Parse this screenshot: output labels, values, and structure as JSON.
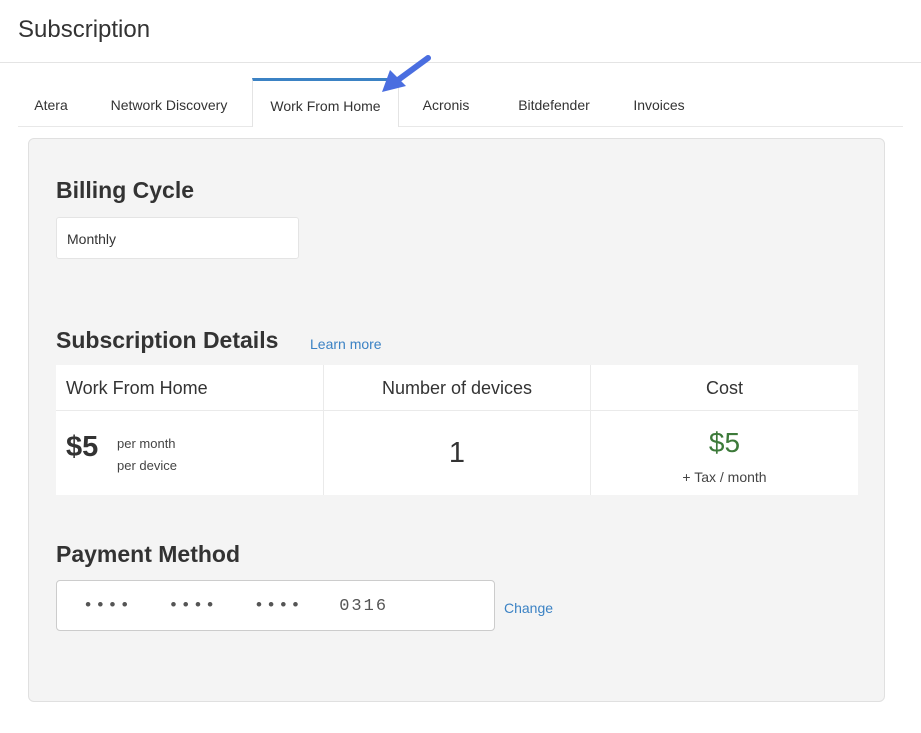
{
  "header": {
    "title": "Subscription"
  },
  "tabs": [
    {
      "label": "Atera",
      "active": false
    },
    {
      "label": "Network Discovery",
      "active": false
    },
    {
      "label": "Work From Home",
      "active": true
    },
    {
      "label": "Acronis",
      "active": false
    },
    {
      "label": "Bitdefender",
      "active": false
    },
    {
      "label": "Invoices",
      "active": false
    }
  ],
  "billing": {
    "title": "Billing Cycle",
    "selected": "Monthly"
  },
  "details": {
    "title": "Subscription Details",
    "learn_more": "Learn more",
    "columns": [
      "Work From Home",
      "Number of devices",
      "Cost"
    ],
    "price": "$5",
    "price_unit_1": "per month",
    "price_unit_2": "per device",
    "devices": "1",
    "cost": "$5",
    "cost_note": "+ Tax / month"
  },
  "payment": {
    "title": "Payment Method",
    "card_masked": "••••   ••••   ••••   0316",
    "change_label": "Change"
  },
  "colors": {
    "accent": "#3b82c4",
    "cost_green": "#3d7a3a",
    "arrow": "#4a6ee0"
  }
}
